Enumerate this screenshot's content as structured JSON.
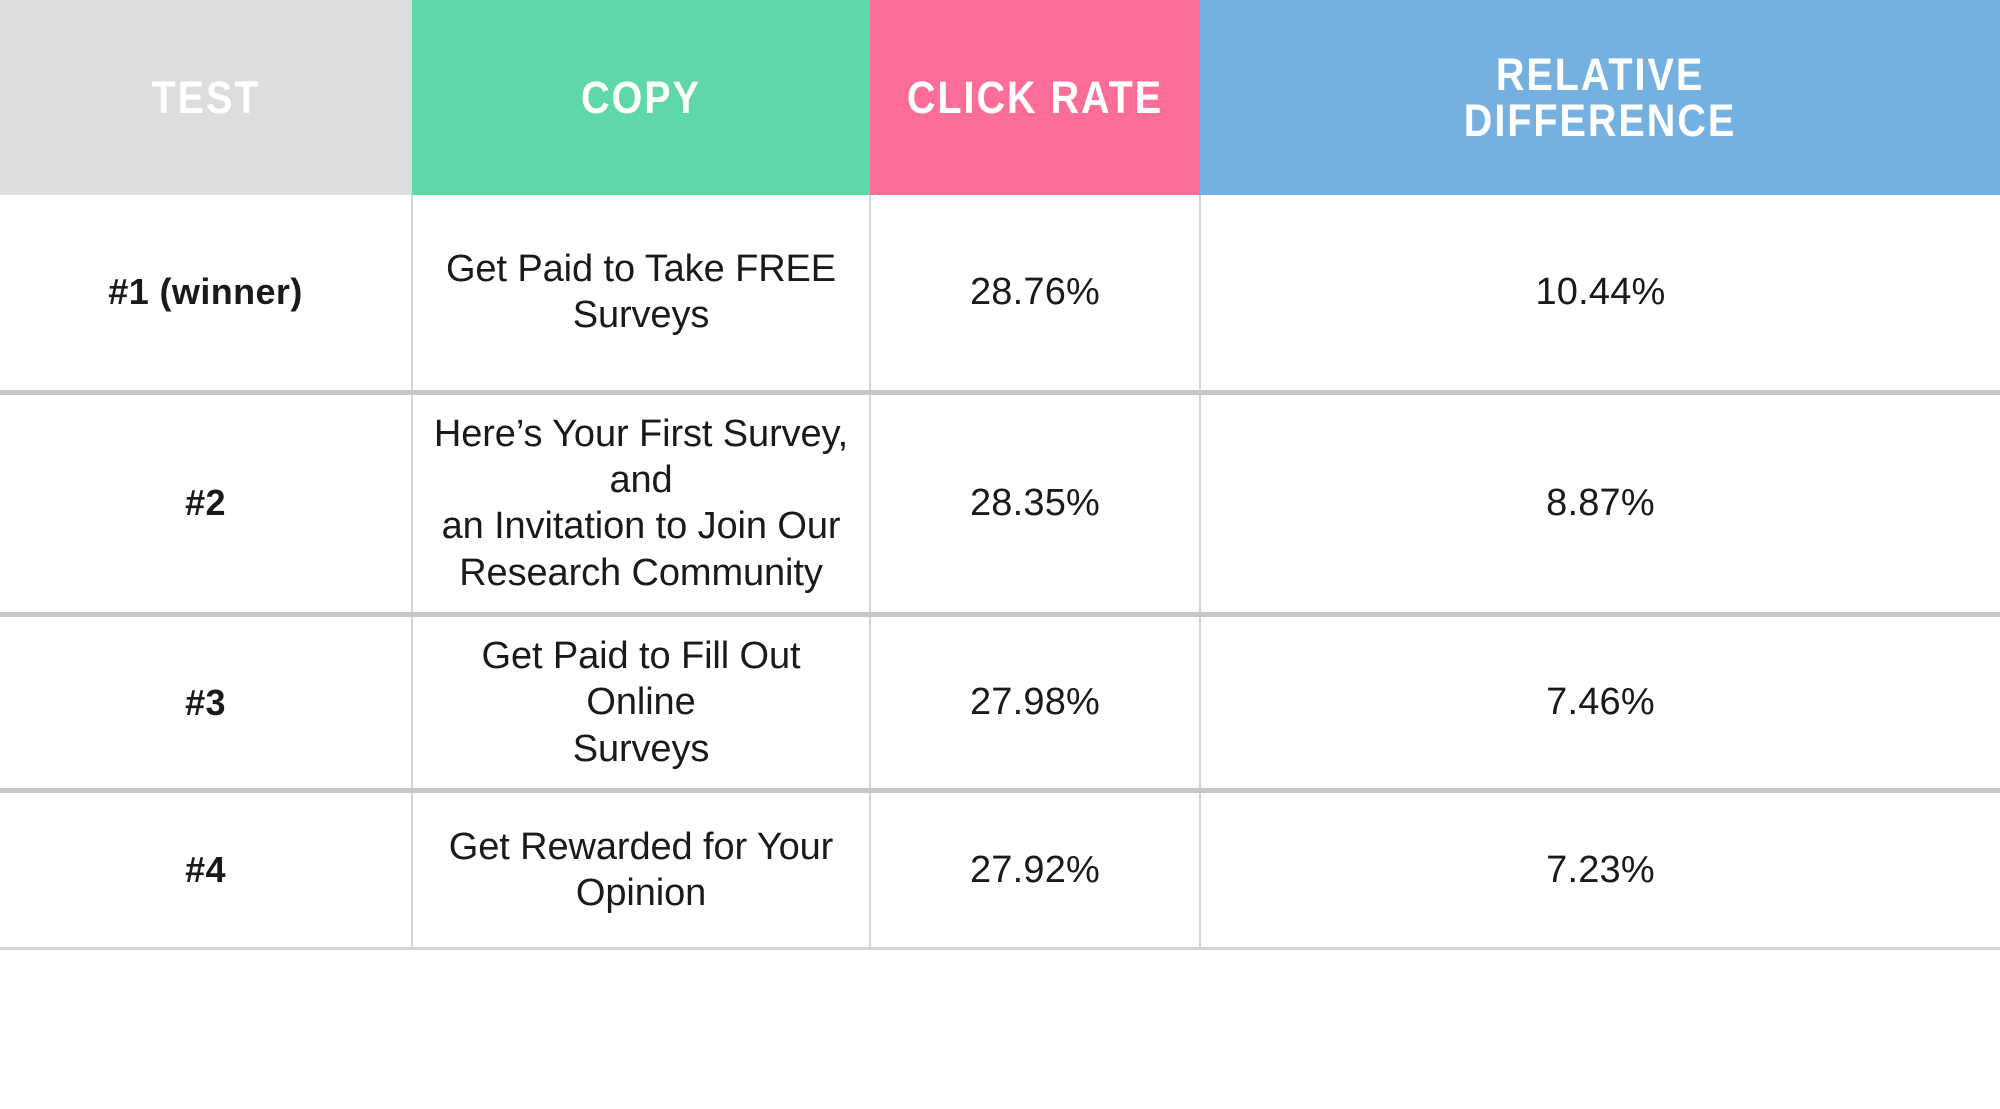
{
  "table": {
    "columns": [
      {
        "key": "test",
        "label": "TEST",
        "header_bg": "#dcdddf",
        "header_text_color": "#ffffff"
      },
      {
        "key": "copy",
        "label": "COPY",
        "header_bg": "#5ed8a8",
        "header_text_color": "#ffffff"
      },
      {
        "key": "click",
        "label": "CLICK RATE",
        "header_bg": "#fc6d98",
        "header_text_color": "#ffffff"
      },
      {
        "key": "reldiff",
        "label_line1": "RELATIVE",
        "label_line2": "DIFFERENCE",
        "header_bg": "#74b1e0",
        "header_text_color": "#ffffff"
      }
    ],
    "rows": [
      {
        "test": "#1 (winner)",
        "copy_line1": "Get Paid to Take FREE",
        "copy_line2": "Surveys",
        "copy_line3": "",
        "click_rate": "28.76%",
        "relative_difference": "10.44%"
      },
      {
        "test": "#2",
        "copy_line1": "Here’s Your First Survey, and",
        "copy_line2": "an Invitation to Join Our",
        "copy_line3": "Research Community",
        "click_rate": "28.35%",
        "relative_difference": "8.87%"
      },
      {
        "test": "#3",
        "copy_line1": "Get Paid to Fill Out Online",
        "copy_line2": "Surveys",
        "copy_line3": "",
        "click_rate": "27.98%",
        "relative_difference": "7.46%"
      },
      {
        "test": "#4",
        "copy_line1": "Get Rewarded for Your",
        "copy_line2": "Opinion",
        "copy_line3": "",
        "click_rate": "27.92%",
        "relative_difference": "7.23%"
      }
    ]
  }
}
